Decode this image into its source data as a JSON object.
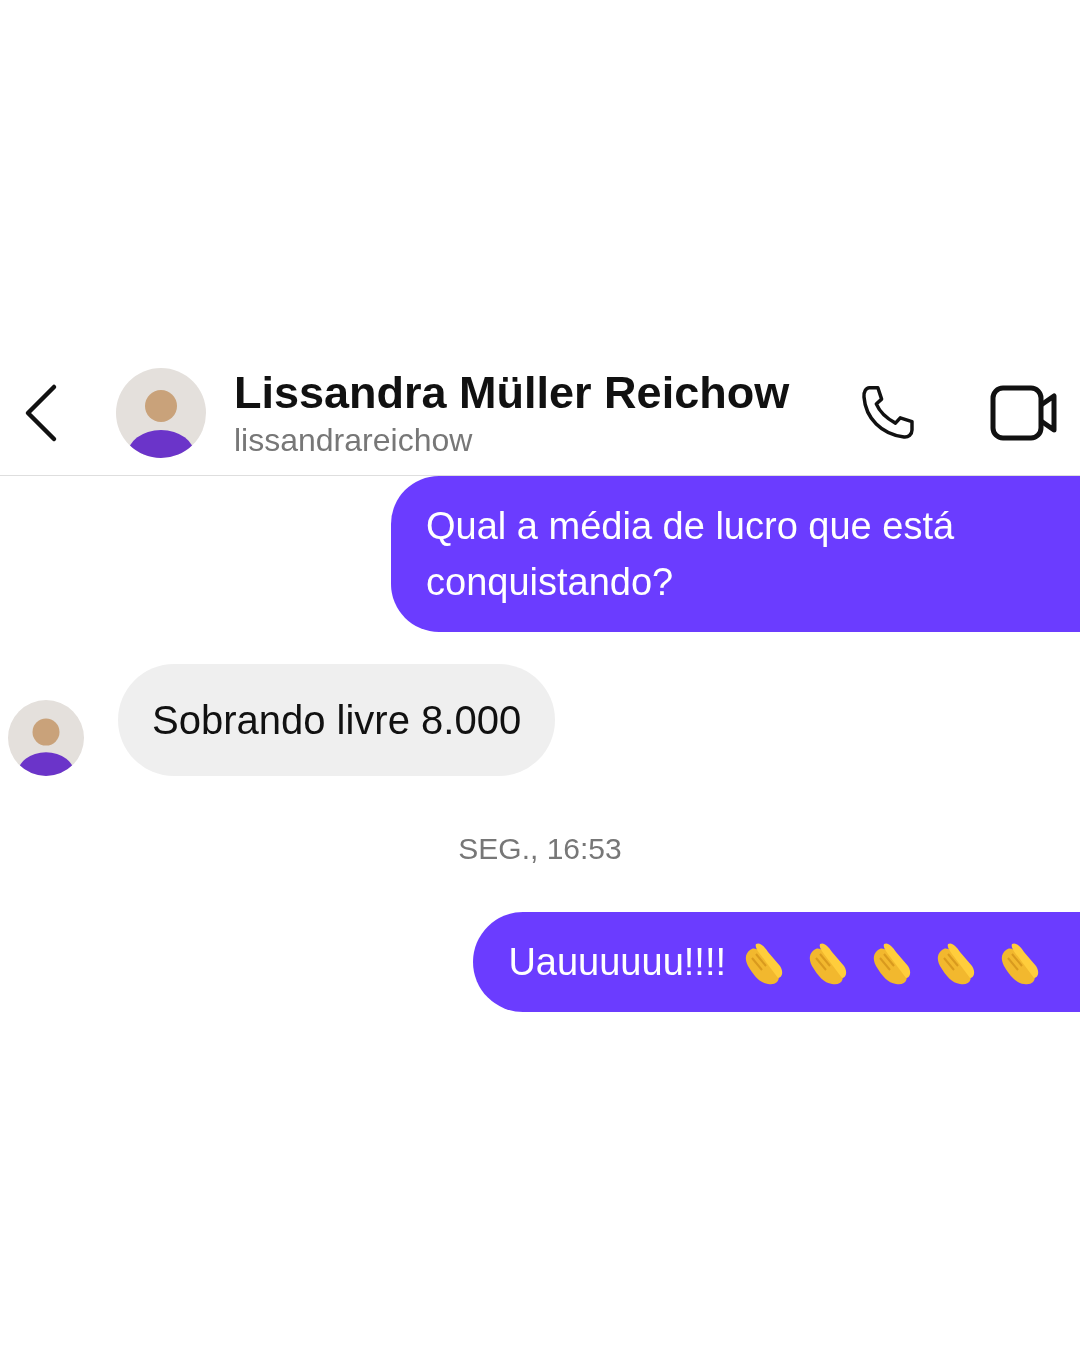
{
  "header": {
    "name": "Lissandra Müller Reichow",
    "username": "lissandrareichow"
  },
  "messages": [
    {
      "kind": "outgoing",
      "text": "Qual a média de lucro que está conquistando?"
    },
    {
      "kind": "incoming",
      "text": "Sobrando livre 8.000"
    },
    {
      "kind": "timestamp",
      "text": "SEG., 16:53"
    },
    {
      "kind": "outgoing",
      "text": "Uauuuuuu!!!!",
      "icons": [
        {
          "kind": "clap"
        },
        {
          "kind": "clap"
        },
        {
          "kind": "clap"
        },
        {
          "kind": "clap"
        },
        {
          "kind": "clap"
        }
      ]
    }
  ]
}
